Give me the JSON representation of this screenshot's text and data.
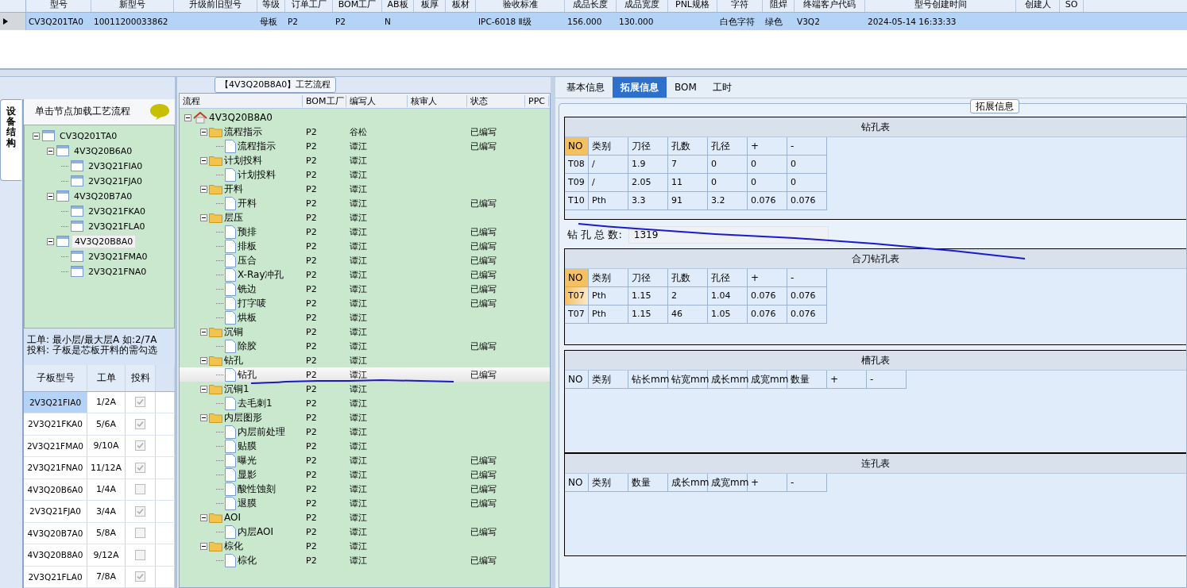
{
  "top_grid": {
    "columns": [
      "型号",
      "新型号",
      "升级前旧型号",
      "等级",
      "订单工厂",
      "BOM工厂",
      "AB板",
      "板厚",
      "板材",
      "验收标准",
      "成品长度",
      "成品宽度",
      "PNL规格",
      "字符",
      "阻焊",
      "终端客户代码",
      "型号创建时间",
      "创建人",
      "SO"
    ],
    "rows": [
      {
        "selected": true,
        "cells": [
          "CV3Q201TA0",
          "10011200033862",
          "",
          "母板",
          "P2",
          "P2",
          "N",
          "",
          "",
          "IPC-6018 Ⅱ级",
          "156.000",
          "130.000",
          "",
          "白色字符",
          "绿色",
          "V3Q2",
          "2024-05-14 16:33:33",
          "",
          ""
        ]
      }
    ]
  },
  "structure_tab": {
    "label": "设备结构",
    "selected": true
  },
  "structure_panel": {
    "hint": "单击节点加载工艺流程",
    "tree": [
      {
        "label": "CV3Q201TA0",
        "expanded": true,
        "selected": false,
        "children": [
          {
            "label": "4V3Q20B6A0",
            "expanded": true,
            "selected": false,
            "children": [
              {
                "label": "2V3Q21FIA0",
                "selected": false
              },
              {
                "label": "2V3Q21FJA0",
                "selected": false
              }
            ]
          },
          {
            "label": "4V3Q20B7A0",
            "expanded": true,
            "selected": false,
            "children": [
              {
                "label": "2V3Q21FKA0",
                "selected": false
              },
              {
                "label": "2V3Q21FLA0",
                "selected": false
              }
            ]
          },
          {
            "label": "4V3Q20B8A0",
            "expanded": true,
            "selected": true,
            "children": [
              {
                "label": "2V3Q21FMA0",
                "selected": false
              },
              {
                "label": "2V3Q21FNA0",
                "selected": false
              }
            ]
          }
        ]
      }
    ],
    "notes": [
      "工单: 最小层/最大层A 如:2/7A",
      "投料: 子板是芯板开料的需勾选"
    ],
    "table": {
      "columns": [
        "子板型号",
        "工单",
        "投料"
      ],
      "rows": [
        {
          "model": "2V3Q21FIA0",
          "order": "1/2A",
          "feed": true,
          "selected": true
        },
        {
          "model": "2V3Q21FKA0",
          "order": "5/6A",
          "feed": true,
          "selected": false
        },
        {
          "model": "2V3Q21FMA0",
          "order": "9/10A",
          "feed": true,
          "selected": false
        },
        {
          "model": "2V3Q21FNA0",
          "order": "11/12A",
          "feed": true,
          "selected": false
        },
        {
          "model": "4V3Q20B6A0",
          "order": "1/4A",
          "feed": false,
          "selected": false
        },
        {
          "model": "2V3Q21FJA0",
          "order": "3/4A",
          "feed": true,
          "selected": false
        },
        {
          "model": "4V3Q20B7A0",
          "order": "5/8A",
          "feed": false,
          "selected": false
        },
        {
          "model": "4V3Q20B8A0",
          "order": "9/12A",
          "feed": false,
          "selected": false
        },
        {
          "model": "2V3Q21FLA0",
          "order": "7/8A",
          "feed": true,
          "selected": false
        }
      ]
    }
  },
  "flow_panel": {
    "title": "【4V3Q20B8A0】工艺流程",
    "columns": [
      "流程",
      "BOM工厂",
      "编写人",
      "核审人",
      "状态",
      "PPC"
    ],
    "root": {
      "label": "4V3Q20B8A0",
      "expanded": true,
      "children": [
        {
          "label": "流程指示",
          "factory": "P2",
          "writer": "谷松",
          "status": "已编写",
          "expanded": true,
          "selected": false,
          "children": [
            {
              "label": "流程指示",
              "factory": "P2",
              "writer": "谭江",
              "status": "已编写",
              "selected": false
            }
          ]
        },
        {
          "label": "计划投料",
          "factory": "P2",
          "writer": "谭江",
          "expanded": true,
          "selected": false,
          "children": [
            {
              "label": "计划投料",
              "factory": "P2",
              "writer": "谭江",
              "selected": false
            }
          ]
        },
        {
          "label": "开料",
          "factory": "P2",
          "writer": "谭江",
          "expanded": true,
          "selected": false,
          "children": [
            {
              "label": "开料",
              "factory": "P2",
              "writer": "谭江",
              "status": "已编写",
              "selected": false
            }
          ]
        },
        {
          "label": "层压",
          "factory": "P2",
          "writer": "谭江",
          "expanded": true,
          "selected": false,
          "children": [
            {
              "label": "预排",
              "factory": "P2",
              "writer": "谭江",
              "status": "已编写",
              "selected": false
            },
            {
              "label": "排板",
              "factory": "P2",
              "writer": "谭江",
              "status": "已编写",
              "selected": false
            },
            {
              "label": "压合",
              "factory": "P2",
              "writer": "谭江",
              "status": "已编写",
              "selected": false
            },
            {
              "label": "X-Ray冲孔",
              "factory": "P2",
              "writer": "谭江",
              "status": "已编写",
              "selected": false
            },
            {
              "label": "铣边",
              "factory": "P2",
              "writer": "谭江",
              "status": "已编写",
              "selected": false
            },
            {
              "label": "打字唛",
              "factory": "P2",
              "writer": "谭江",
              "status": "已编写",
              "selected": false
            },
            {
              "label": "烘板",
              "factory": "P2",
              "writer": "谭江",
              "selected": false
            }
          ]
        },
        {
          "label": "沉铜",
          "factory": "P2",
          "writer": "谭江",
          "expanded": true,
          "selected": false,
          "children": [
            {
              "label": "除胶",
              "factory": "P2",
              "writer": "谭江",
              "status": "已编写",
              "selected": false
            }
          ]
        },
        {
          "label": "钻孔",
          "factory": "P2",
          "writer": "谭江",
          "expanded": true,
          "selected": false,
          "children": [
            {
              "label": "钻孔",
              "factory": "P2",
              "writer": "谭江",
              "status": "已编写",
              "selected": true
            }
          ]
        },
        {
          "label": "沉铜1",
          "factory": "P2",
          "writer": "谭江",
          "expanded": true,
          "selected": false,
          "children": [
            {
              "label": "去毛刺1",
              "factory": "P2",
              "writer": "谭江",
              "selected": false
            }
          ]
        },
        {
          "label": "内层图形",
          "factory": "P2",
          "writer": "谭江",
          "expanded": true,
          "selected": false,
          "children": [
            {
              "label": "内层前处理",
              "factory": "P2",
              "writer": "谭江",
              "selected": false
            },
            {
              "label": "贴膜",
              "factory": "P2",
              "writer": "谭江",
              "selected": false
            },
            {
              "label": "曝光",
              "factory": "P2",
              "writer": "谭江",
              "status": "已编写",
              "selected": false
            },
            {
              "label": "显影",
              "factory": "P2",
              "writer": "谭江",
              "status": "已编写",
              "selected": false
            },
            {
              "label": "酸性蚀刻",
              "factory": "P2",
              "writer": "谭江",
              "status": "已编写",
              "selected": false
            },
            {
              "label": "退膜",
              "factory": "P2",
              "writer": "谭江",
              "status": "已编写",
              "selected": false
            }
          ]
        },
        {
          "label": "AOI",
          "factory": "P2",
          "writer": "谭江",
          "expanded": true,
          "selected": false,
          "children": [
            {
              "label": "内层AOI",
              "factory": "P2",
              "writer": "谭江",
              "status": "已编写",
              "selected": false
            }
          ]
        },
        {
          "label": "棕化",
          "factory": "P2",
          "writer": "谭江",
          "expanded": true,
          "selected": false,
          "children": [
            {
              "label": "棕化",
              "factory": "P2",
              "writer": "谭江",
              "status": "已编写",
              "selected": false
            }
          ]
        }
      ]
    }
  },
  "detail_panel": {
    "tabs": [
      {
        "label": "基本信息",
        "selected": false
      },
      {
        "label": "拓展信息",
        "selected": true
      },
      {
        "label": "BOM",
        "selected": false
      },
      {
        "label": "工时",
        "selected": false
      }
    ],
    "group_title": "拓展信息",
    "sections": [
      {
        "kind": "table",
        "title": "钻孔表",
        "columns": [
          "NO",
          "类别",
          "刀径",
          "孔数",
          "孔径",
          "+",
          "-"
        ],
        "rows": [
          {
            "selected": false,
            "cells": [
              "T08",
              "/",
              "1.9",
              "7",
              "0",
              "0",
              "0"
            ]
          },
          {
            "selected": false,
            "cells": [
              "T09",
              "/",
              "2.05",
              "11",
              "0",
              "0",
              "0"
            ]
          },
          {
            "selected": false,
            "cells": [
              "T10",
              "Pth",
              "3.3",
              "91",
              "3.2",
              "0.076",
              "0.076"
            ]
          }
        ]
      },
      {
        "kind": "total",
        "label": "钻 孔 总 数:",
        "value": "1319"
      },
      {
        "kind": "table",
        "title": "合刀钻孔表",
        "columns": [
          "NO",
          "类别",
          "刀径",
          "孔数",
          "孔径",
          "+",
          "-"
        ],
        "rows": [
          {
            "selected": true,
            "cells": [
              "T07",
              "Pth",
              "1.15",
              "2",
              "1.04",
              "0.076",
              "0.076"
            ]
          },
          {
            "selected": false,
            "cells": [
              "T07",
              "Pth",
              "1.15",
              "46",
              "1.05",
              "0.076",
              "0.076"
            ]
          }
        ]
      },
      {
        "kind": "table",
        "title": "槽孔表",
        "columns": [
          "NO",
          "类别",
          "钻长mm",
          "钻宽mm",
          "成长mm",
          "成宽mm",
          "数量",
          "+",
          "-"
        ]
      },
      {
        "kind": "table",
        "title": "连孔表",
        "columns": [
          "NO",
          "类别",
          "数量",
          "成长mm",
          "成宽mm",
          "+",
          "-"
        ]
      }
    ]
  }
}
